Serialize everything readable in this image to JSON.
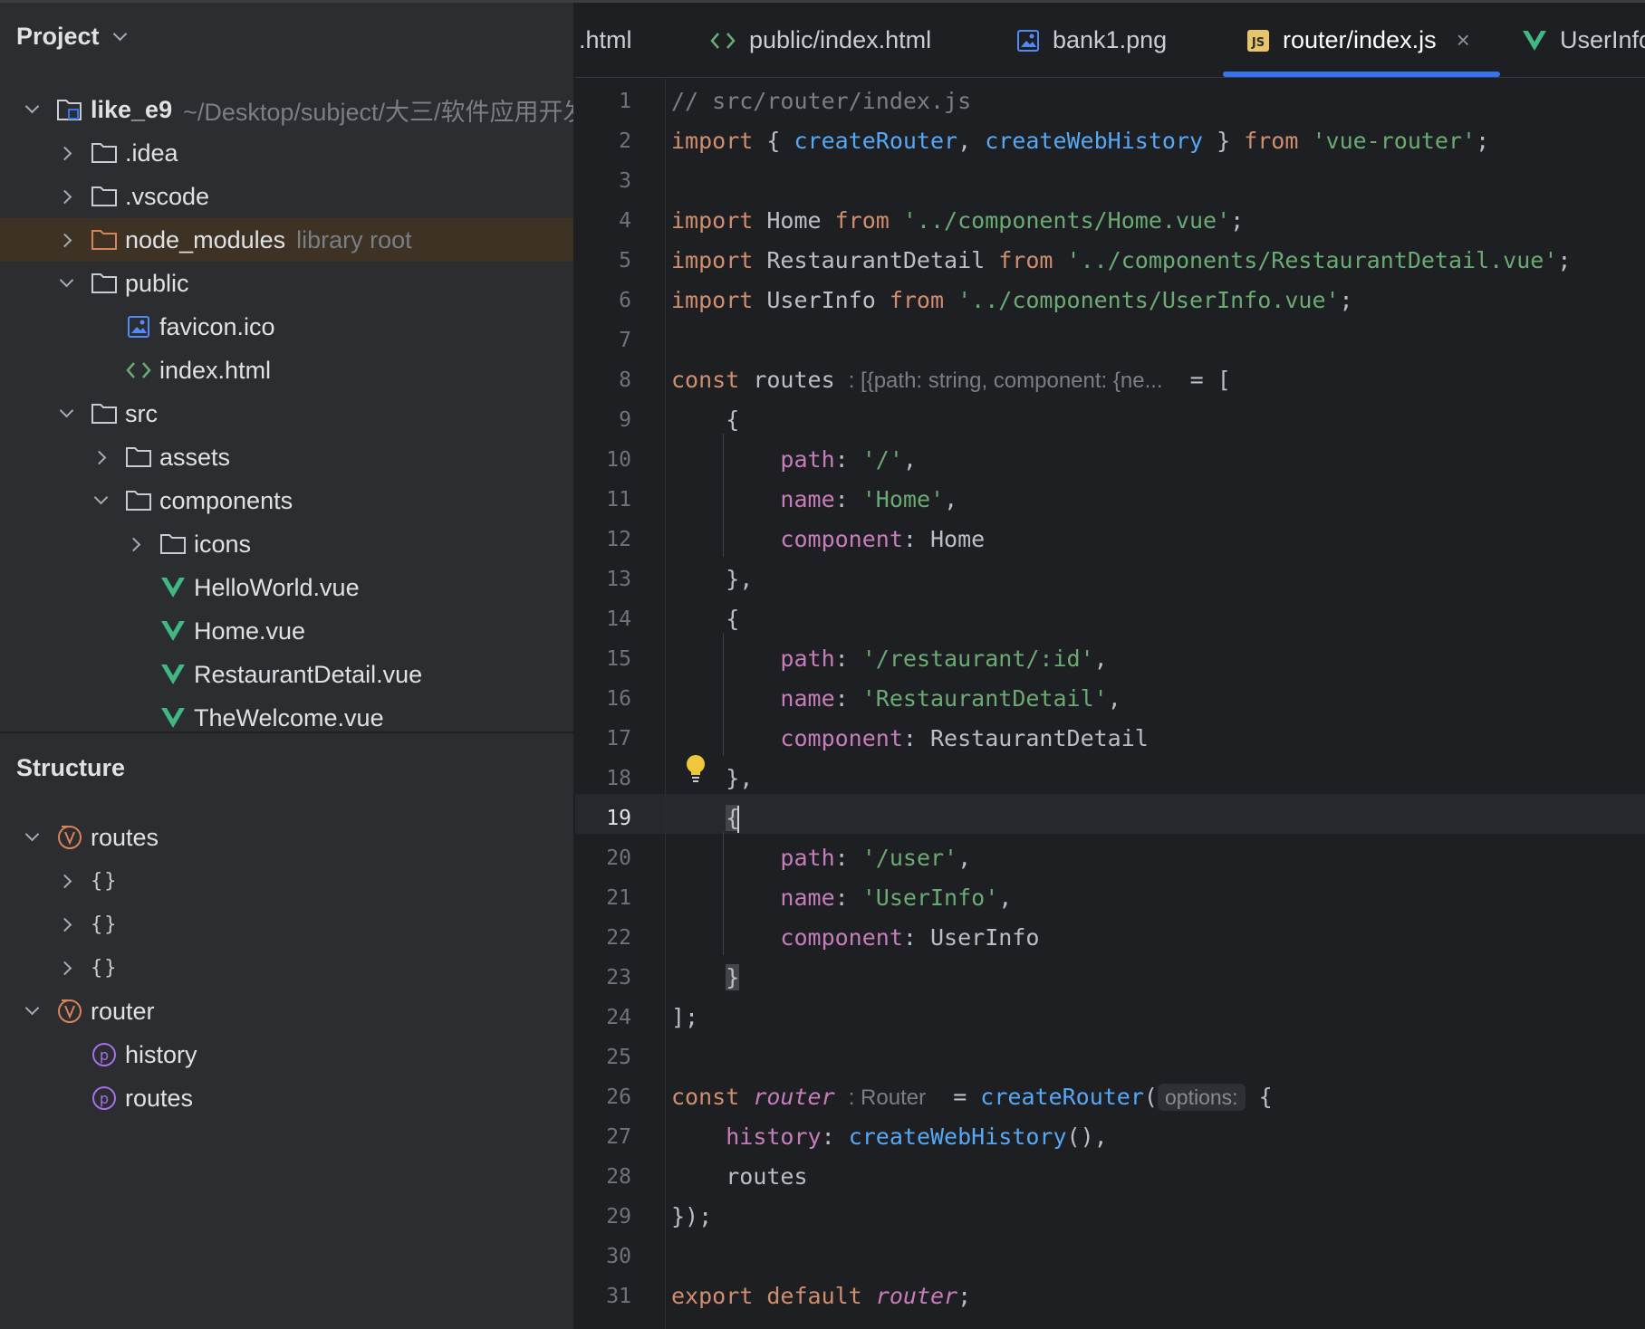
{
  "project_panel": {
    "title": "Project",
    "tree": [
      {
        "label": "like_e9",
        "hint": "~/Desktop/subject/大三/软件应用开发",
        "icon": "project-folder-icon",
        "expanded": true
      },
      {
        "label": ".idea",
        "icon": "folder-icon",
        "expanded": false
      },
      {
        "label": ".vscode",
        "icon": "folder-icon",
        "expanded": false
      },
      {
        "label": "node_modules",
        "hint": "library root",
        "icon": "folder-icon",
        "expanded": false
      },
      {
        "label": "public",
        "icon": "folder-icon",
        "expanded": true
      },
      {
        "label": "favicon.ico",
        "icon": "image-file-icon"
      },
      {
        "label": "index.html",
        "icon": "html-file-icon"
      },
      {
        "label": "src",
        "icon": "folder-icon",
        "expanded": true
      },
      {
        "label": "assets",
        "icon": "folder-icon",
        "expanded": false
      },
      {
        "label": "components",
        "icon": "folder-icon",
        "expanded": true
      },
      {
        "label": "icons",
        "icon": "folder-icon",
        "expanded": false
      },
      {
        "label": "HelloWorld.vue",
        "icon": "vue-file-icon"
      },
      {
        "label": "Home.vue",
        "icon": "vue-file-icon"
      },
      {
        "label": "RestaurantDetail.vue",
        "icon": "vue-file-icon"
      },
      {
        "label": "TheWelcome.vue",
        "icon": "vue-file-icon"
      }
    ]
  },
  "structure_panel": {
    "title": "Structure",
    "items": [
      {
        "label": "routes",
        "icon": "variable-icon"
      },
      {
        "label": "{}",
        "icon": "object-literal"
      },
      {
        "label": "{}",
        "icon": "object-literal"
      },
      {
        "label": "{}",
        "icon": "object-literal"
      },
      {
        "label": "router",
        "icon": "variable-icon"
      },
      {
        "label": "history",
        "icon": "property-icon"
      },
      {
        "label": "routes",
        "icon": "property-icon"
      }
    ]
  },
  "editor": {
    "tabs": [
      {
        "label": ".html",
        "icon": "none"
      },
      {
        "label": "public/index.html",
        "icon": "html-file-icon"
      },
      {
        "label": "bank1.png",
        "icon": "image-file-icon"
      },
      {
        "label": "router/index.js",
        "icon": "js-file-icon",
        "active": true,
        "close": "×"
      },
      {
        "label": "UserInfo",
        "icon": "vue-file-icon"
      }
    ],
    "current_line": 19,
    "lines": {
      "l1": "// src/router/index.js",
      "l2_import": "import",
      "l2_a": " { ",
      "l2_createRouter": "createRouter",
      "l2_comma": ", ",
      "l2_createWebHistory": "createWebHistory",
      "l2_b": " } ",
      "l2_from": "from",
      "l2_str": "'vue-router'",
      "l2_end": ";",
      "l4_import": "import",
      "l4_name": " Home ",
      "l4_from": "from",
      "l4_str": "'../components/Home.vue'",
      "l4_end": ";",
      "l5_import": "import",
      "l5_name": " RestaurantDetail ",
      "l5_from": "from",
      "l5_str": "'../components/RestaurantDetail.vue'",
      "l5_end": ";",
      "l6_import": "import",
      "l6_name": " UserInfo ",
      "l6_from": "from",
      "l6_str": "'../components/UserInfo.vue'",
      "l6_end": ";",
      "l8_const": "const",
      "l8_name": " routes ",
      "l8_hint": ": [{path: string, component: {ne...",
      "l8_end": "  = [",
      "open": "{",
      "close": "},",
      "close_last": "}",
      "path_key": "path",
      "name_key": "name",
      "component_key": "component",
      "colon": ": ",
      "comma": ",",
      "l10_val": "'/'",
      "l11_val": "'Home'",
      "l12_val": "Home",
      "l15_val": "'/restaurant/:id'",
      "l16_val": "'RestaurantDetail'",
      "l17_val": "RestaurantDetail",
      "l20_val": "'/user'",
      "l21_val": "'UserInfo'",
      "l22_val": "UserInfo",
      "l24": "];",
      "l26_const": "const",
      "l26_name": "router",
      "l26_hint": ": Router",
      "l26_eq": " = ",
      "l26_fn": "createRouter",
      "l26_paren": "(",
      "l26_opt": "options:",
      "l26_brace": " {",
      "l27_key": "history",
      "l27_fn": "createWebHistory",
      "l27_end": "(),",
      "l28": "routes",
      "l29": "});",
      "l31_export": "export",
      "l31_default": " default ",
      "l31_name": "router",
      "l31_end": ";"
    }
  },
  "colors": {
    "accent": "#3574f0",
    "keyword": "#cf8e6d",
    "string": "#6aab73",
    "function": "#56a8f5",
    "property": "#c77dbb",
    "vue_green": "#41b883"
  }
}
